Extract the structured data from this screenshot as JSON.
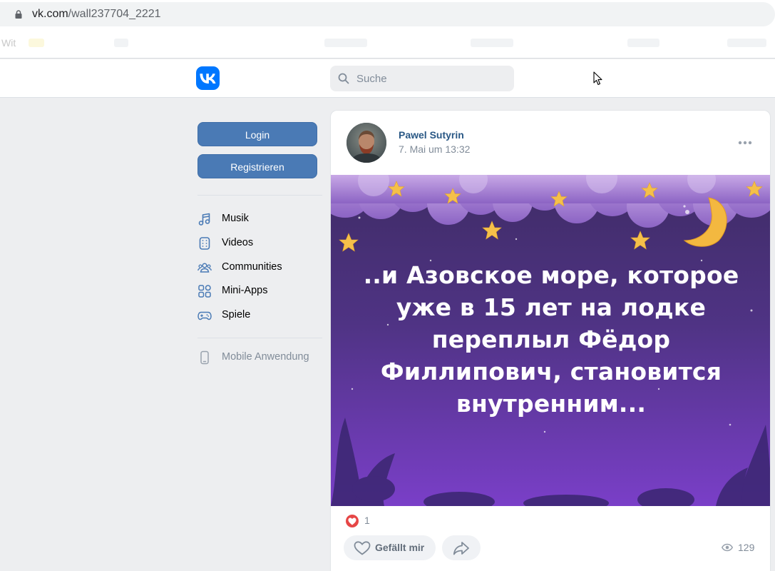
{
  "browser": {
    "url_host": "vk.com",
    "url_path": "/wall237704_2221",
    "bookmark_stub": "Wit"
  },
  "header": {
    "search_placeholder": "Suche"
  },
  "sidebar": {
    "login_label": "Login",
    "register_label": "Registrieren",
    "items": [
      {
        "label": "Musik",
        "icon": "music-note-icon"
      },
      {
        "label": "Videos",
        "icon": "video-icon"
      },
      {
        "label": "Communities",
        "icon": "users-icon"
      },
      {
        "label": "Mini-Apps",
        "icon": "apps-grid-icon"
      },
      {
        "label": "Spiele",
        "icon": "gamepad-icon"
      }
    ],
    "mobile_label": "Mobile Anwendung"
  },
  "post": {
    "author": "Pawel Sutyrin",
    "date": "7. Mai um 13:32",
    "image_text_lines": [
      "..и Азовское море, которое",
      "уже в 15 лет на лодке",
      "переплыл Фёдор",
      "Филлипович, становится",
      "внутренним..."
    ],
    "reactions_count": "1",
    "like_label": "Gefällt mir",
    "views_count": "129"
  },
  "colors": {
    "vk_blue": "#0077ff",
    "button_blue": "#4a7ab5",
    "link": "#2a5885",
    "muted": "#818c99",
    "page_bg": "#edeef0",
    "image_purple_top": "#45306e",
    "image_purple_bottom": "#7b3fc6"
  }
}
